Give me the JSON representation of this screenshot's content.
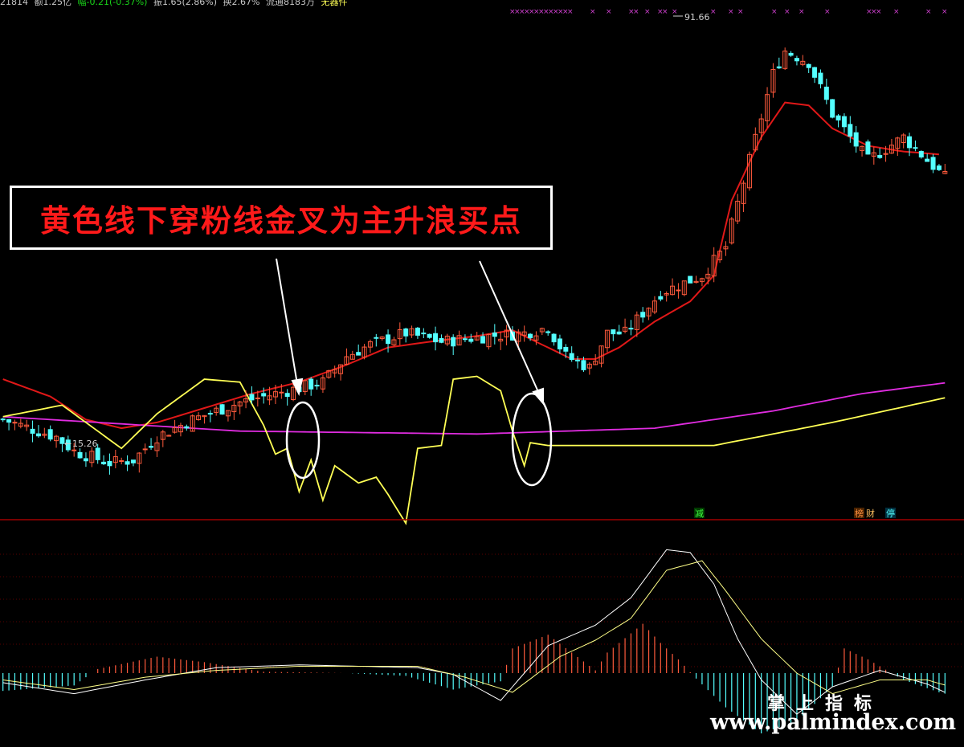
{
  "header": {
    "items": [
      {
        "text": "21814",
        "color": "#c8c8c8"
      },
      {
        "text": "额1.25亿",
        "color": "#c8c8c8"
      },
      {
        "text": "幅-0.21(-0.37%)",
        "color": "#19d219"
      },
      {
        "text": "振1.65(2.86%)",
        "color": "#c8c8c8"
      },
      {
        "text": "换2.67%",
        "color": "#c8c8c8"
      },
      {
        "text": "流通8183万",
        "color": "#c8c8c8"
      },
      {
        "text": "无器件",
        "color": "#ffff55"
      }
    ]
  },
  "callout": {
    "text": "黄色线下穿粉线金叉为主升浪买点"
  },
  "annotations": {
    "high_label": "91.66",
    "low_label": "15.26",
    "marker_jian": "减",
    "marker_bang": "榜",
    "marker_cai": "财",
    "marker_ting": "停"
  },
  "watermark": {
    "cn": "掌上指标",
    "url": "www.palmindex.com"
  },
  "colors": {
    "up": "#ff5a3c",
    "down": "#54ffff",
    "ma_red": "#e01818",
    "ma_magenta": "#e02ce0",
    "yellow": "#ffff55",
    "divider": "#a00000",
    "macd_dif": "#ffffff",
    "macd_dea": "#ffff88"
  },
  "chart_data": [
    {
      "type": "candlestick",
      "panel": "price",
      "x_count": 160,
      "ylim": [
        10,
        95
      ],
      "high": 91.66,
      "low": 15.26,
      "close_points": [
        [
          0,
          25
        ],
        [
          9,
          22
        ],
        [
          12,
          19.5
        ],
        [
          18,
          17.5
        ],
        [
          22,
          18
        ],
        [
          26,
          22
        ],
        [
          32,
          25
        ],
        [
          40,
          28
        ],
        [
          48,
          30
        ],
        [
          54,
          31.5
        ],
        [
          58,
          36
        ],
        [
          62,
          38
        ],
        [
          68,
          40
        ],
        [
          74,
          38.5
        ],
        [
          82,
          39.5
        ],
        [
          88,
          40
        ],
        [
          92,
          41
        ],
        [
          95,
          36
        ],
        [
          99,
          34
        ],
        [
          102,
          40
        ],
        [
          105,
          40
        ],
        [
          111,
          47
        ],
        [
          118,
          50
        ],
        [
          122,
          55
        ],
        [
          126,
          70
        ],
        [
          130,
          85
        ],
        [
          132,
          89
        ],
        [
          136,
          87
        ],
        [
          140,
          78
        ],
        [
          146,
          70
        ],
        [
          152,
          74
        ],
        [
          158,
          68
        ],
        [
          160,
          66
        ]
      ],
      "series": [
        {
          "name": "MA",
          "color": "#e01818",
          "points": [
            [
              0,
              32
            ],
            [
              8,
              29
            ],
            [
              14,
              25
            ],
            [
              20,
              23.5
            ],
            [
              26,
              24.5
            ],
            [
              34,
              27
            ],
            [
              42,
              29.5
            ],
            [
              50,
              31.5
            ],
            [
              58,
              34.5
            ],
            [
              65,
              37.5
            ],
            [
              72,
              38.5
            ],
            [
              80,
              39.5
            ],
            [
              86,
              40.5
            ],
            [
              90,
              38.5
            ],
            [
              96,
              35.5
            ],
            [
              100,
              35.5
            ],
            [
              104,
              37.5
            ],
            [
              110,
              42
            ],
            [
              116,
              45.5
            ],
            [
              120,
              50
            ],
            [
              123,
              63
            ],
            [
              128,
              74
            ],
            [
              132,
              80
            ],
            [
              136,
              79.5
            ],
            [
              140,
              75.5
            ],
            [
              146,
              72.5
            ],
            [
              152,
              71.5
            ],
            [
              158,
              71
            ]
          ]
        },
        {
          "name": "MA-long",
          "color": "#e02ce0",
          "points": [
            [
              0,
              25.5
            ],
            [
              40,
              23
            ],
            [
              80,
              22.5
            ],
            [
              110,
              23.5
            ],
            [
              130,
              26.5
            ],
            [
              145,
              29.5
            ],
            [
              160,
              31.5
            ]
          ]
        },
        {
          "name": "yellow-line",
          "color": "#ffff55",
          "points": [
            [
              0,
              25.5
            ],
            [
              10,
              27.5
            ],
            [
              20,
              20
            ],
            [
              26,
              26
            ],
            [
              34,
              32
            ],
            [
              40,
              31.5
            ],
            [
              44,
              24
            ],
            [
              46,
              19
            ],
            [
              48,
              20
            ],
            [
              50,
              12.5
            ],
            [
              52,
              18
            ],
            [
              54,
              11
            ],
            [
              56,
              17
            ],
            [
              60,
              14
            ],
            [
              63,
              15
            ],
            [
              65,
              12
            ],
            [
              68,
              7
            ],
            [
              70,
              20
            ],
            [
              74,
              20.5
            ],
            [
              76,
              32
            ],
            [
              80,
              32.5
            ],
            [
              84,
              30
            ],
            [
              86,
              23
            ],
            [
              88,
              17
            ],
            [
              89,
              21
            ],
            [
              92,
              20.5
            ],
            [
              120,
              20.5
            ],
            [
              140,
              24.5
            ],
            [
              160,
              29
            ]
          ]
        }
      ]
    },
    {
      "type": "bar",
      "panel": "macd",
      "title": "",
      "x_count": 160,
      "ylim": [
        -6,
        10
      ],
      "histogram_knots": [
        [
          0,
          -1.3
        ],
        [
          12,
          -0.9
        ],
        [
          16,
          0.3
        ],
        [
          26,
          1.2
        ],
        [
          34,
          0.8
        ],
        [
          44,
          0.1
        ],
        [
          58,
          0
        ],
        [
          68,
          -0.2
        ],
        [
          76,
          -1.2
        ],
        [
          84,
          -0.6
        ],
        [
          86,
          1.8
        ],
        [
          92,
          2.8
        ],
        [
          96,
          1.5
        ],
        [
          100,
          0.2
        ],
        [
          102,
          1.5
        ],
        [
          108,
          3.6
        ],
        [
          111,
          2.2
        ],
        [
          114,
          1.0
        ],
        [
          117,
          -0.4
        ],
        [
          122,
          -2.5
        ],
        [
          128,
          -4.4
        ],
        [
          134,
          -3.5
        ],
        [
          140,
          -1.0
        ],
        [
          142,
          1.8
        ],
        [
          146,
          1.0
        ],
        [
          152,
          -0.5
        ],
        [
          158,
          -1.4
        ],
        [
          160,
          -1.6
        ]
      ],
      "series": [
        {
          "name": "DIF",
          "color": "#ffffff",
          "points": [
            [
              0,
              -0.7
            ],
            [
              12,
              -1.5
            ],
            [
              24,
              -0.5
            ],
            [
              36,
              0.4
            ],
            [
              50,
              0.6
            ],
            [
              70,
              0.4
            ],
            [
              76,
              -0.1
            ],
            [
              84,
              -2.0
            ],
            [
              92,
              2.0
            ],
            [
              100,
              3.5
            ],
            [
              106,
              5.5
            ],
            [
              112,
              9.0
            ],
            [
              116,
              8.8
            ],
            [
              120,
              6.5
            ],
            [
              124,
              2.5
            ],
            [
              128,
              -0.5
            ],
            [
              134,
              -3.0
            ],
            [
              140,
              -1.0
            ],
            [
              148,
              0.2
            ],
            [
              156,
              -0.8
            ],
            [
              160,
              -1.6
            ]
          ]
        },
        {
          "name": "DEA",
          "color": "#ffff88",
          "points": [
            [
              0,
              -0.5
            ],
            [
              12,
              -1.2
            ],
            [
              24,
              -0.3
            ],
            [
              36,
              0.2
            ],
            [
              50,
              0.5
            ],
            [
              70,
              0.5
            ],
            [
              78,
              -0.3
            ],
            [
              86,
              -1.4
            ],
            [
              94,
              1.2
            ],
            [
              100,
              2.4
            ],
            [
              106,
              4.0
            ],
            [
              112,
              7.5
            ],
            [
              118,
              8.2
            ],
            [
              122,
              6.0
            ],
            [
              128,
              2.5
            ],
            [
              134,
              0
            ],
            [
              140,
              -1.5
            ],
            [
              148,
              -0.5
            ],
            [
              156,
              -0.5
            ],
            [
              160,
              -1.0
            ]
          ]
        }
      ]
    }
  ]
}
